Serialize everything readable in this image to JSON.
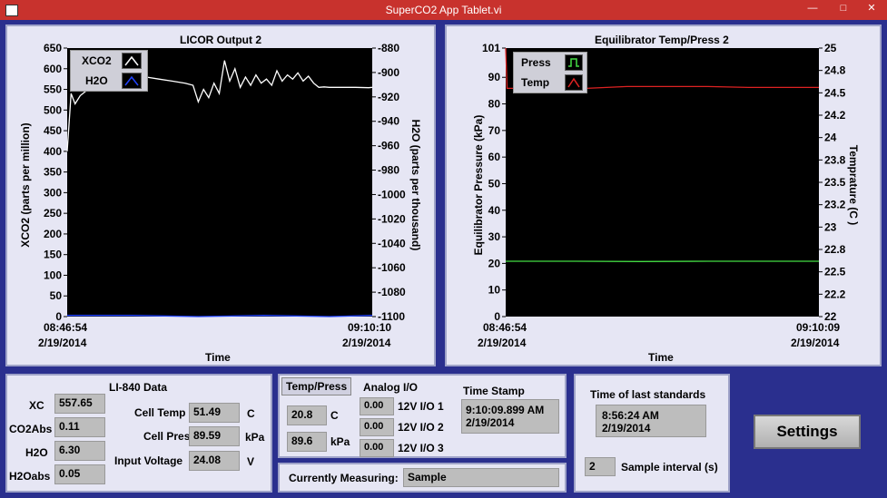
{
  "window": {
    "title": "SuperCO2 App Tablet.vi"
  },
  "licor_chart": {
    "title": "LICOR Output 2",
    "ylabel_left": "XCO2 (parts per million)",
    "ylabel_right": "H2O (parts per thousand)",
    "xlabel": "Time",
    "x_start_time": "08:46:54",
    "x_start_date": "2/19/2014",
    "x_end_time": "09:10:10",
    "x_end_date": "2/19/2014",
    "legend": [
      {
        "label": "XCO2"
      },
      {
        "label": "H2O"
      }
    ]
  },
  "equil_chart": {
    "title": "Equilibrator Temp/Press 2",
    "ylabel_left": "Equilibrator Pressure (kPa)",
    "ylabel_right": "Temprature (C )",
    "xlabel": "Time",
    "x_start_time": "08:46:54",
    "x_start_date": "2/19/2014",
    "x_end_time": "09:10:09",
    "x_end_date": "2/19/2014",
    "legend": [
      {
        "label": "Press"
      },
      {
        "label": "Temp"
      }
    ]
  },
  "chart_data": [
    {
      "type": "line",
      "title": "LICOR Output 2",
      "xlabel": "Time",
      "ylabel": "XCO2 (parts per million)",
      "y2label": "H2O (parts per thousand)",
      "ylim": [
        0,
        650
      ],
      "y2lim": [
        -1100,
        -880
      ],
      "yticks": [
        0,
        50,
        100,
        150,
        200,
        250,
        300,
        350,
        400,
        450,
        500,
        550,
        600,
        650
      ],
      "y2ticks": [
        -880,
        -900,
        -920,
        -940,
        -960,
        -980,
        -1000,
        -1020,
        -1040,
        -1060,
        -1080,
        -1100
      ],
      "grid": false,
      "legend_position": "top-left",
      "series": [
        {
          "name": "XCO2",
          "color": "#ffffff",
          "axis": "left",
          "x": [
            0,
            0.3,
            0.6,
            1.0,
            1.4,
            2.0,
            2.6,
            3.0,
            4.0,
            5.0,
            6.0,
            7.0,
            8.0,
            9.0,
            9.6,
            10.0,
            10.4,
            10.8,
            11.2,
            11.6,
            12.0,
            12.4,
            12.8,
            13.2,
            13.6,
            14.0,
            14.4,
            14.8,
            15.2,
            15.6,
            16.0,
            16.4,
            16.8,
            17.2,
            17.6,
            18.0,
            18.4,
            18.8,
            19.2,
            19.6,
            20.0,
            21.0,
            22.0,
            23.0,
            23.27
          ],
          "y": [
            400,
            540,
            515,
            535,
            545,
            560,
            575,
            582,
            580,
            578,
            580,
            575,
            570,
            565,
            560,
            520,
            550,
            530,
            565,
            540,
            620,
            570,
            600,
            555,
            580,
            560,
            585,
            565,
            575,
            560,
            595,
            570,
            585,
            575,
            590,
            570,
            582,
            565,
            555,
            556,
            555,
            555,
            555,
            554,
            555
          ]
        },
        {
          "name": "H2O",
          "color": "#2244ff",
          "axis": "right",
          "x": [
            0,
            5,
            10,
            15,
            20,
            23.27
          ],
          "y": [
            -1099,
            -1099,
            -1100,
            -1099,
            -1100,
            -1099
          ]
        }
      ]
    },
    {
      "type": "line",
      "title": "Equilibrator Temp/Press 2",
      "xlabel": "Time",
      "ylabel": "Equilibrator Pressure (kPa)",
      "y2label": "Temprature (C )",
      "ylim": [
        0,
        101
      ],
      "y2lim": [
        22,
        25
      ],
      "yticks": [
        0,
        10,
        20,
        30,
        40,
        50,
        60,
        70,
        80,
        90,
        101
      ],
      "y2ticks": [
        "22",
        "22.2",
        "22.5",
        "22.8",
        "23",
        "23.2",
        "23.5",
        "23.8",
        "24",
        "24.2",
        "24.5",
        "24.8",
        "25"
      ],
      "grid": false,
      "legend_position": "top-left",
      "series": [
        {
          "name": "Press",
          "color": "#44dd44",
          "axis": "left",
          "x": [
            0,
            5,
            10,
            15,
            20,
            23.25
          ],
          "y": [
            20.8,
            20.8,
            20.7,
            20.8,
            20.8,
            20.8
          ]
        },
        {
          "name": "Temp",
          "color": "#dd2222",
          "axis": "right",
          "x": [
            0,
            0.1,
            3,
            6,
            9,
            12,
            15,
            18,
            21,
            23.25
          ],
          "y": [
            25,
            24.55,
            24.55,
            24.55,
            24.57,
            24.57,
            24.57,
            24.56,
            24.56,
            24.56
          ]
        }
      ]
    }
  ],
  "li840": {
    "title": "LI-840 Data",
    "xc_label": "XC",
    "xc_value": "557.65",
    "co2abs_label": "CO2Abs",
    "co2abs_value": "0.11",
    "h2o_label": "H2O",
    "h2o_value": "6.30",
    "h2oabs_label": "H2Oabs",
    "h2oabs_value": "0.05",
    "cell_temp_label": "Cell Temp",
    "cell_temp_value": "51.49",
    "cell_temp_unit": "C",
    "cell_pres_label": "Cell Pres",
    "cell_pres_value": "89.59",
    "cell_pres_unit": "kPa",
    "input_voltage_label": "Input Voltage",
    "input_voltage_value": "24.08",
    "input_voltage_unit": "V"
  },
  "temp_press": {
    "tab_label": "Temp/Press",
    "temp_value": "20.8",
    "temp_unit": "C",
    "press_value": "89.6",
    "press_unit": "kPa"
  },
  "analog_io": {
    "title": "Analog I/O",
    "io1_value": "0.00",
    "io1_label": "12V I/O 1",
    "io2_value": "0.00",
    "io2_label": "12V I/O 2",
    "io3_value": "0.00",
    "io3_label": "12V I/O 3"
  },
  "time_stamp": {
    "title": "Time Stamp",
    "time": "9:10:09.899 AM",
    "date": "2/19/2014"
  },
  "measuring": {
    "label": "Currently Measuring:",
    "value": "Sample"
  },
  "standards": {
    "title": "Time of last standards",
    "time": "8:56:24 AM",
    "date": "2/19/2014",
    "interval_value": "2",
    "interval_label": "Sample interval (s)"
  },
  "settings_button": {
    "label": "Settings"
  }
}
